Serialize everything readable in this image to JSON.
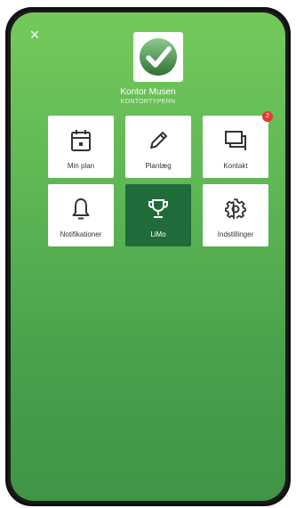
{
  "header": {
    "close_label": "×",
    "account_name": "Kontor Musen",
    "account_sub": "KONTORTYPERN"
  },
  "colors": {
    "background_top": "#75c95b",
    "background_bottom": "#3f9546",
    "tile_active": "#1f6b3a",
    "badge": "#e53935",
    "logo_check": "#4caf50"
  },
  "menu": {
    "items": [
      {
        "label": "Min plan",
        "icon": "calendar-icon"
      },
      {
        "label": "Planlæg",
        "icon": "pencil-icon"
      },
      {
        "label": "Kontakt",
        "icon": "chat-icon",
        "badge": "2"
      },
      {
        "label": "Notifikationer",
        "icon": "bell-icon"
      },
      {
        "label": "LiMo",
        "icon": "trophy-icon",
        "active": true
      },
      {
        "label": "Indstillinger",
        "icon": "gear-icon"
      }
    ]
  }
}
